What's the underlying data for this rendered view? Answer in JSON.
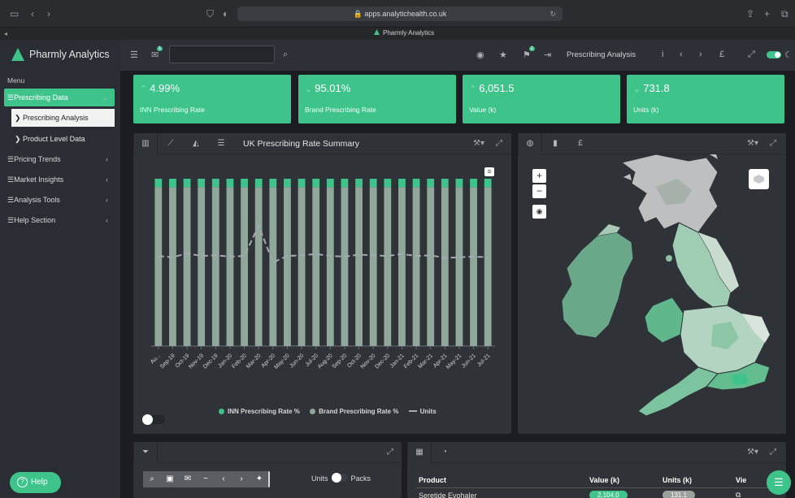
{
  "browser": {
    "url": "apps.analytichealth.co.uk",
    "tab_title": "Pharmly Analytics"
  },
  "header": {
    "brand": "Pharmly Analytics",
    "messages_badge": "1",
    "notify_badge": "1",
    "search_placeholder": "",
    "page_title": "Prescribing Analysis",
    "currency": "£"
  },
  "sidebar": {
    "menu_label": "Menu",
    "items": [
      {
        "label": "☰Prescribing Data",
        "chev": "⌄"
      },
      {
        "label": "❯ Prescribing Analysis"
      },
      {
        "label": "❯ Product Level Data"
      },
      {
        "label": "☰Pricing Trends",
        "chev": "‹"
      },
      {
        "label": "☰Market Insights",
        "chev": "‹"
      },
      {
        "label": "☰Analysis Tools",
        "chev": "‹"
      },
      {
        "label": "☰Help Section",
        "chev": "‹"
      }
    ],
    "help_label": "Help"
  },
  "kpis": [
    {
      "value": "4.99%",
      "label": "INN Prescribing Rate"
    },
    {
      "value": "95.01%",
      "label": "Brand Prescribing Rate"
    },
    {
      "value": "6,051.5",
      "label": "Value (k)"
    },
    {
      "value": "731.8",
      "label": "Units (k)"
    }
  ],
  "chart_panel": {
    "title": "UK Prescribing Rate Summary",
    "legend": [
      "INN Prescribing Rate %",
      "Brand Prescribing Rate %",
      "Units"
    ]
  },
  "chart_data": {
    "type": "bar",
    "stacked": true,
    "title": "UK Prescribing Rate Summary",
    "categories": [
      "Au...",
      "Sep-19",
      "Oct-19",
      "Nov-19",
      "Dec-19",
      "Jan-20",
      "Feb-20",
      "Mar-20",
      "Apr-20",
      "May-20",
      "Jun-20",
      "Jul-20",
      "Aug-20",
      "Sep-20",
      "Oct-20",
      "Nov-20",
      "Dec-20",
      "Jan-21",
      "Feb-21",
      "Mar-21",
      "Apr-21",
      "May-21",
      "Jun-21",
      "Jul-21"
    ],
    "ylim": [
      0,
      100
    ],
    "series": [
      {
        "name": "INN Prescribing Rate %",
        "color": "#3ec48b",
        "values": [
          5,
          5,
          5,
          5,
          5,
          5,
          5,
          5,
          5,
          5,
          5,
          5,
          5,
          5,
          5,
          5,
          5,
          5,
          5,
          5,
          5,
          5,
          5,
          5
        ]
      },
      {
        "name": "Brand Prescribing Rate %",
        "color": "#8fa89b",
        "values": [
          95,
          95,
          95,
          95,
          95,
          95,
          95,
          95,
          95,
          95,
          95,
          95,
          95,
          95,
          95,
          95,
          95,
          95,
          95,
          95,
          95,
          95,
          95,
          95
        ]
      },
      {
        "name": "Units",
        "color": "#a5aaae",
        "type": "line",
        "values": [
          700,
          690,
          720,
          700,
          705,
          695,
          700,
          935,
          650,
          700,
          705,
          715,
          700,
          695,
          710,
          705,
          700,
          715,
          700,
          705,
          685,
          690,
          695,
          690
        ]
      }
    ],
    "units_range": [
      0,
      1300
    ],
    "grid": false,
    "legend_position": "bottom"
  },
  "bottom_left": {
    "toggle_left": "Units",
    "toggle_right": "Packs"
  },
  "table": {
    "columns": [
      "Product",
      "Value (k)",
      "Units (k)",
      "Vie"
    ],
    "rows": [
      {
        "product": "Seretide Evohaler",
        "value": "2,104.0",
        "units": "131.1"
      }
    ]
  },
  "colors": {
    "accent": "#3ec48b",
    "panel": "#2f3237",
    "background": "#1b1d22"
  }
}
